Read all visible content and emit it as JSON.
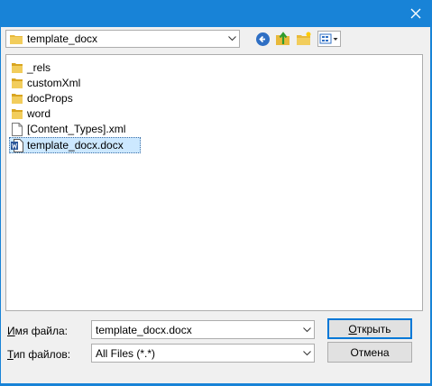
{
  "path_combo": {
    "value": "template_docx"
  },
  "toolbar": {
    "back_icon": "back-arrow-icon",
    "up_icon": "up-folder-icon",
    "new_folder_icon": "new-folder-icon",
    "view_icon": "view-menu-icon"
  },
  "files": [
    {
      "name": "_rels",
      "type": "folder"
    },
    {
      "name": "customXml",
      "type": "folder"
    },
    {
      "name": "docProps",
      "type": "folder"
    },
    {
      "name": "word",
      "type": "folder"
    },
    {
      "name": "[Content_Types].xml",
      "type": "file"
    },
    {
      "name": "template_docx.docx",
      "type": "docx",
      "selected": true
    }
  ],
  "filename": {
    "label_key": "И",
    "label_rest": "мя файла:",
    "value": "template_docx.docx"
  },
  "filetype": {
    "label_key": "Т",
    "label_rest": "ип файлов:",
    "value": "All Files (*.*)"
  },
  "buttons": {
    "open_key": "О",
    "open_rest": "ткрыть",
    "cancel": "Отмена"
  },
  "colors": {
    "accent": "#1883d7",
    "selection": "#cce8ff",
    "folder": "#e8b93a"
  }
}
